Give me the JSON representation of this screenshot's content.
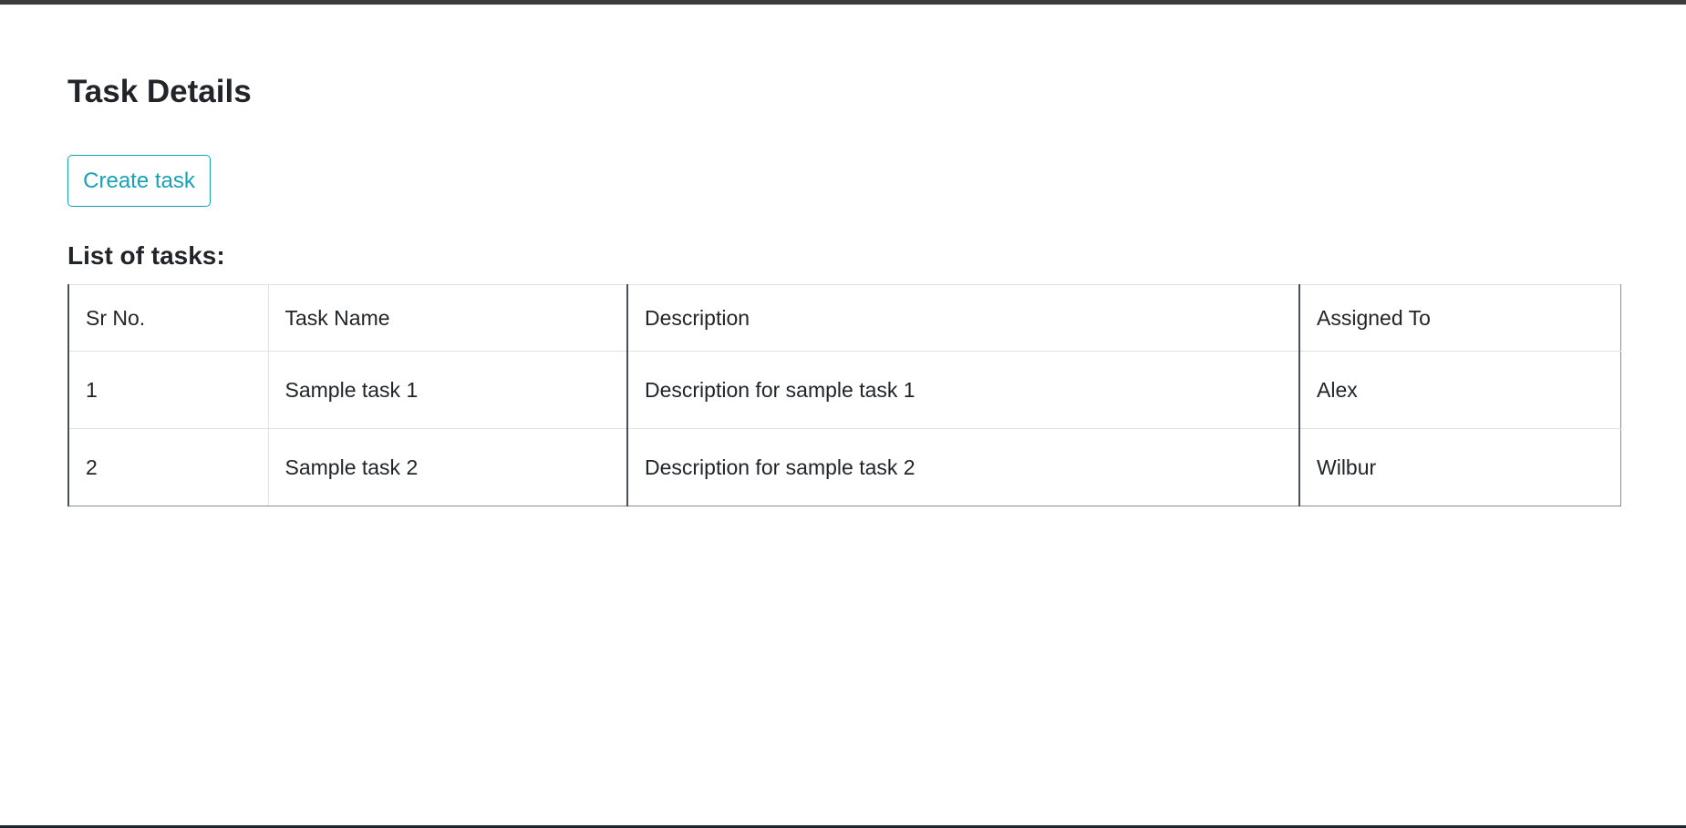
{
  "page": {
    "title": "Task Details"
  },
  "actions": {
    "create_task_label": "Create task"
  },
  "tasks_section": {
    "heading": "List of tasks:"
  },
  "table": {
    "columns": [
      "Sr No.",
      "Task Name",
      "Description",
      "Assigned To"
    ],
    "rows": [
      [
        "1",
        "Sample task 1",
        "Description for sample task 1",
        "Alex"
      ],
      [
        "2",
        "Sample task 2",
        "Description for sample task 2",
        "Wilbur"
      ]
    ]
  },
  "colors": {
    "accent": "#17a2b8",
    "text": "#212529",
    "border": "#dee2e6"
  }
}
